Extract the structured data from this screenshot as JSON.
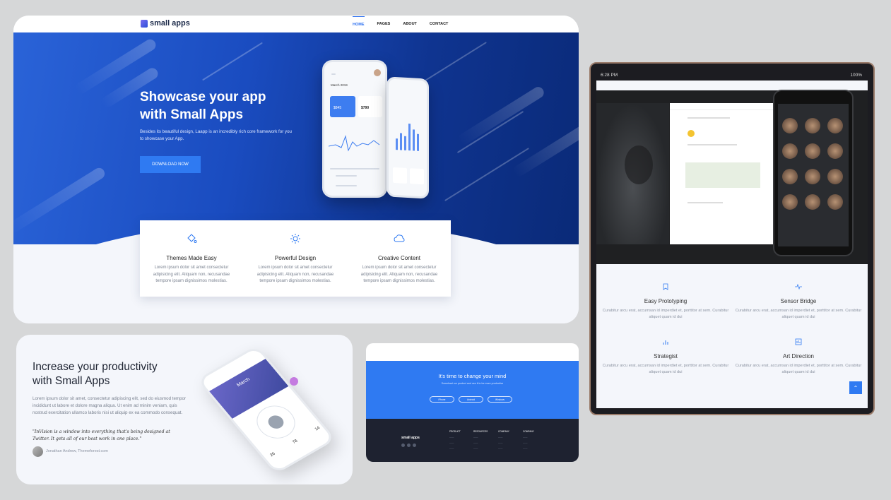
{
  "main": {
    "logo": "small apps",
    "nav": [
      "HOME",
      "PAGES",
      "ABOUT",
      "CONTACT"
    ],
    "hero_title_1": "Showcase your app",
    "hero_title_2": "with Small Apps",
    "hero_sub": "Besides its beautiful design, Laapp is an incredibly rich core framework for you to showcase your App.",
    "hero_button": "DOWNLOAD NOW",
    "phone_month": "March 2019",
    "phone_amount1": "$845",
    "phone_amount2": "$790",
    "features": [
      {
        "icon": "paint-bucket-icon",
        "title": "Themes Made Easy",
        "text": "Lorem ipsum dolor sit amet consectetur adipisicing elit. Aliquam non, recusandae tempore ipsam dignissimos molestias."
      },
      {
        "icon": "sun-icon",
        "title": "Powerful Design",
        "text": "Lorem ipsum dolor sit amet consectetur adipisicing elit. Aliquam non, recusandae tempore ipsam dignissimos molestias."
      },
      {
        "icon": "cloud-icon",
        "title": "Creative Content",
        "text": "Lorem ipsum dolor sit amet consectetur adipisicing elit. Aliquam non, recusandae tempore ipsam dignissimos molestias."
      }
    ]
  },
  "productivity": {
    "title_1": "Increase your productivity",
    "title_2": "with Small Apps",
    "text": "Lorem ipsum dolor sit amet, consectetur adipiscing elit, sed do eiusmod tempor incididunt ut labore et dolore magna aliqua. Ut enim ad minim veniam, quis nostrud exercitation ullamco laboris nisi ut aliquip ex ea commodo consequat.",
    "quote": "\"InVision is a window into everything that's being designed at Twitter. It gets all of our best work in one place.\"",
    "author": "Jonathan Andrew, Themeforest.com",
    "phone_month": "March",
    "stats": [
      "26",
      "78",
      "14"
    ]
  },
  "cta": {
    "title": "It's time to change your mind",
    "sub": "Download our product and use it to be more productive",
    "buttons": [
      "iPhone",
      "Android",
      "Windows"
    ],
    "footer_logo": "small apps",
    "footer_cols": [
      "PRODUCT",
      "RESOURCES",
      "COMPANY",
      "COMPANY"
    ]
  },
  "tablet": {
    "time": "6:28 PM",
    "battery": "100%",
    "features": [
      {
        "icon": "bookmark-icon",
        "title": "Easy Prototyping",
        "text": "Curabitur arcu erat, accumsan id imperdiet et, porttitor at sem. Curabitur aliquet quam id dui"
      },
      {
        "icon": "pulse-icon",
        "title": "Sensor Bridge",
        "text": "Curabitur arcu erat, accumsan id imperdiet et, porttitor at sem. Curabitur aliquet quam id dui"
      },
      {
        "icon": "bar-chart-icon",
        "title": "Strategist",
        "text": "Curabitur arcu erat, accumsan id imperdiet et, porttitor at sem. Curabitur aliquet quam id dui"
      },
      {
        "icon": "image-frame-icon",
        "title": "Art Direction",
        "text": "Curabitur arcu erat, accumsan id imperdiet et, porttitor at sem. Curabitur aliquet quam id dui"
      }
    ]
  }
}
